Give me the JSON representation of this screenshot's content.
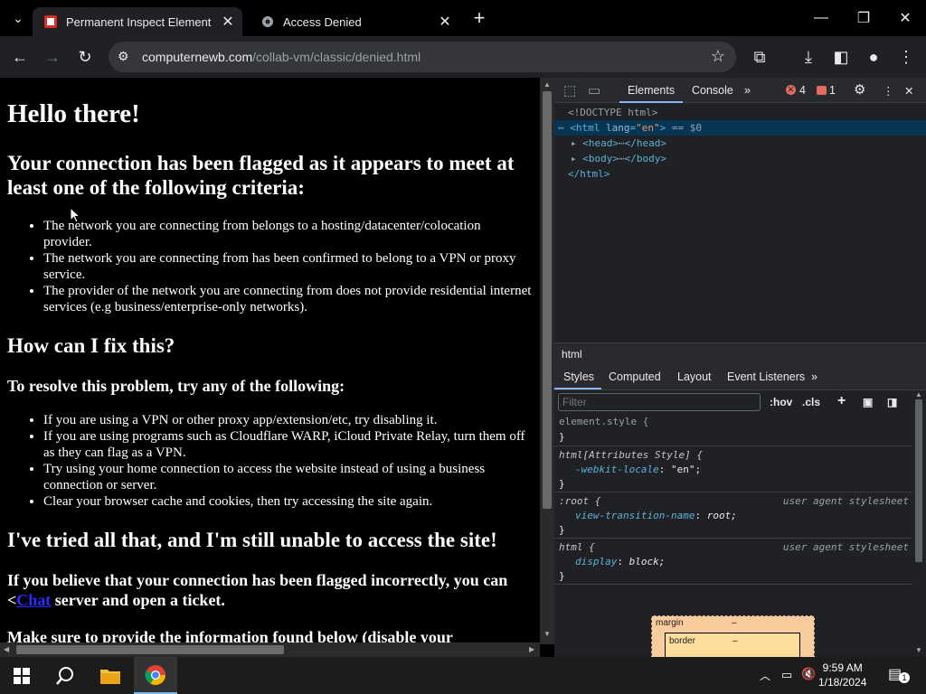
{
  "browser": {
    "tabs": [
      {
        "title": "Permanent Inspect Element",
        "icon": "extension-favicon"
      },
      {
        "title": "Access Denied",
        "icon": "site-favicon"
      }
    ],
    "url_host": "computernewb.com",
    "url_path": "/collab-vm/classic/denied.html"
  },
  "page": {
    "h1": "Hello there!",
    "criteria_heading": "Your connection has been flagged as it appears to meet at least one of the following criteria:",
    "criteria": [
      "The network you are connecting from belongs to a hosting/datacenter/colocation provider.",
      "The network you are connecting from has been confirmed to belong to a VPN or proxy service.",
      "The provider of the network you are connecting from does not provide residential internet services (e.g business/enterprise-only networks)."
    ],
    "fix_heading": "How can I fix this?",
    "fix_sub": "To resolve this problem, try any of the following:",
    "fixes": [
      "If you are using a VPN or other proxy app/extension/etc, try disabling it.",
      "If you are using programs such as Cloudflare WARP, iCloud Private Relay, turn them off as they can flag as a VPN.",
      "Try using your home connection to access the website instead of using a business connection or server.",
      "Clear your browser cache and cookies, then try accessing the site again."
    ],
    "tried_heading": "I've tried all that, and I'm still unable to access the site!",
    "incorrect_pre": "If you believe that your connection has been flagged incorrectly, you can <",
    "incorrect_link": "Chat",
    "incorrect_post": " server and open a ticket.",
    "info_line": "Make sure to provide the information found below (disable your"
  },
  "devtools": {
    "tabs": {
      "elements": "Elements",
      "console": "Console"
    },
    "error_count": "4",
    "issue_count": "1",
    "dom": {
      "doctype": "<!DOCTYPE html>",
      "html_open": "<html",
      "lang_attr": "lang",
      "lang_val": "\"en\"",
      "html_close_bracket": ">",
      "selected_marker": "== $0",
      "head": "<head>",
      "head_close": "</head>",
      "body": "<body>",
      "body_close": "</body>",
      "html_close": "</html>"
    },
    "breadcrumb": "html",
    "style_tabs": [
      "Styles",
      "Computed",
      "Layout",
      "Event Listeners"
    ],
    "filter_placeholder": "Filter",
    "hov": ":hov",
    "cls": ".cls",
    "rules": {
      "element_style": "element.style {",
      "close": "}",
      "attr_selector": "html[Attributes Style] {",
      "attr_prop": "-webkit-locale",
      "attr_val": "\"en\";",
      "root_selector": ":root {",
      "ua_label": "user agent stylesheet",
      "root_prop": "view-transition-name",
      "root_val": "root;",
      "html_selector": "html {",
      "html_prop": "display",
      "html_val": "block;"
    },
    "boxmodel": {
      "margin": "margin",
      "border": "border",
      "dash": "–"
    }
  },
  "taskbar": {
    "time": "9:59 AM",
    "date": "1/18/2024",
    "notif_count": "1"
  }
}
